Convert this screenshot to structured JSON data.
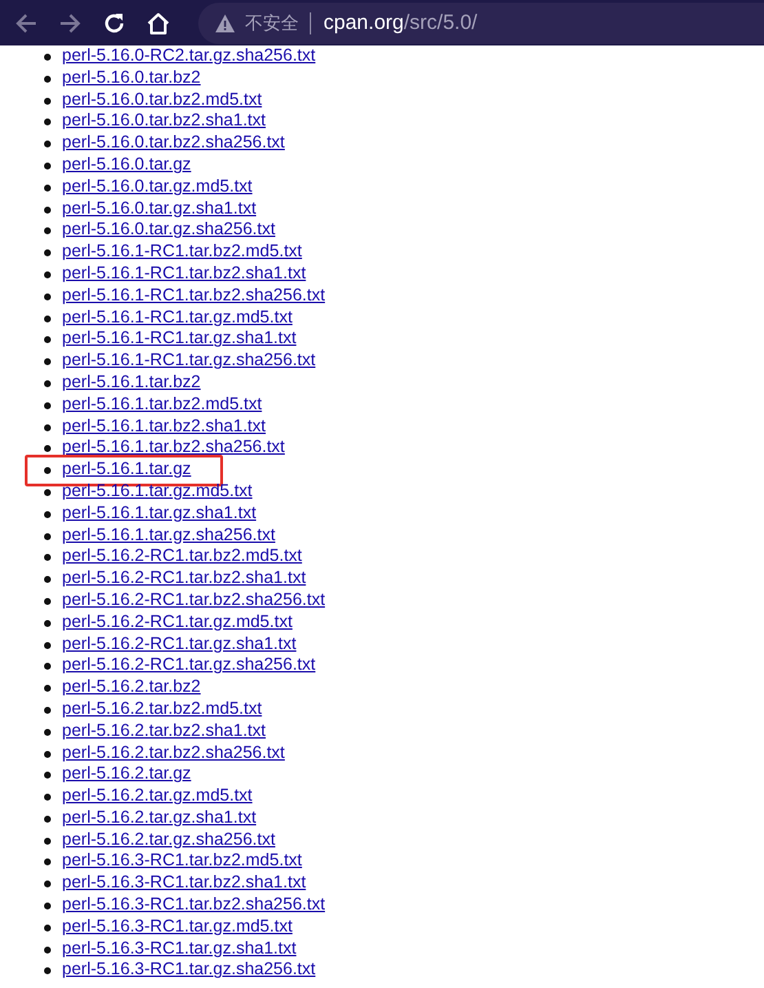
{
  "toolbar": {
    "back_disabled": true,
    "forward_disabled": true,
    "security_label": "不安全",
    "url_host": "cpan.org",
    "url_path": "/src/5.0/"
  },
  "files": [
    {
      "name": "perl-5.16.0-RC2.tar.gz.sha256.txt",
      "highlighted": false
    },
    {
      "name": "perl-5.16.0.tar.bz2",
      "highlighted": false
    },
    {
      "name": "perl-5.16.0.tar.bz2.md5.txt",
      "highlighted": false
    },
    {
      "name": "perl-5.16.0.tar.bz2.sha1.txt",
      "highlighted": false
    },
    {
      "name": "perl-5.16.0.tar.bz2.sha256.txt",
      "highlighted": false
    },
    {
      "name": "perl-5.16.0.tar.gz",
      "highlighted": false
    },
    {
      "name": "perl-5.16.0.tar.gz.md5.txt",
      "highlighted": false
    },
    {
      "name": "perl-5.16.0.tar.gz.sha1.txt",
      "highlighted": false
    },
    {
      "name": "perl-5.16.0.tar.gz.sha256.txt",
      "highlighted": false
    },
    {
      "name": "perl-5.16.1-RC1.tar.bz2.md5.txt",
      "highlighted": false
    },
    {
      "name": "perl-5.16.1-RC1.tar.bz2.sha1.txt",
      "highlighted": false
    },
    {
      "name": "perl-5.16.1-RC1.tar.bz2.sha256.txt",
      "highlighted": false
    },
    {
      "name": "perl-5.16.1-RC1.tar.gz.md5.txt",
      "highlighted": false
    },
    {
      "name": "perl-5.16.1-RC1.tar.gz.sha1.txt",
      "highlighted": false
    },
    {
      "name": "perl-5.16.1-RC1.tar.gz.sha256.txt",
      "highlighted": false
    },
    {
      "name": "perl-5.16.1.tar.bz2",
      "highlighted": false
    },
    {
      "name": "perl-5.16.1.tar.bz2.md5.txt",
      "highlighted": false
    },
    {
      "name": "perl-5.16.1.tar.bz2.sha1.txt",
      "highlighted": false
    },
    {
      "name": "perl-5.16.1.tar.bz2.sha256.txt",
      "highlighted": false
    },
    {
      "name": "perl-5.16.1.tar.gz",
      "highlighted": true
    },
    {
      "name": "perl-5.16.1.tar.gz.md5.txt",
      "highlighted": false
    },
    {
      "name": "perl-5.16.1.tar.gz.sha1.txt",
      "highlighted": false
    },
    {
      "name": "perl-5.16.1.tar.gz.sha256.txt",
      "highlighted": false
    },
    {
      "name": "perl-5.16.2-RC1.tar.bz2.md5.txt",
      "highlighted": false
    },
    {
      "name": "perl-5.16.2-RC1.tar.bz2.sha1.txt",
      "highlighted": false
    },
    {
      "name": "perl-5.16.2-RC1.tar.bz2.sha256.txt",
      "highlighted": false
    },
    {
      "name": "perl-5.16.2-RC1.tar.gz.md5.txt",
      "highlighted": false
    },
    {
      "name": "perl-5.16.2-RC1.tar.gz.sha1.txt",
      "highlighted": false
    },
    {
      "name": "perl-5.16.2-RC1.tar.gz.sha256.txt",
      "highlighted": false
    },
    {
      "name": "perl-5.16.2.tar.bz2",
      "highlighted": false
    },
    {
      "name": "perl-5.16.2.tar.bz2.md5.txt",
      "highlighted": false
    },
    {
      "name": "perl-5.16.2.tar.bz2.sha1.txt",
      "highlighted": false
    },
    {
      "name": "perl-5.16.2.tar.bz2.sha256.txt",
      "highlighted": false
    },
    {
      "name": "perl-5.16.2.tar.gz",
      "highlighted": false
    },
    {
      "name": "perl-5.16.2.tar.gz.md5.txt",
      "highlighted": false
    },
    {
      "name": "perl-5.16.2.tar.gz.sha1.txt",
      "highlighted": false
    },
    {
      "name": "perl-5.16.2.tar.gz.sha256.txt",
      "highlighted": false
    },
    {
      "name": "perl-5.16.3-RC1.tar.bz2.md5.txt",
      "highlighted": false
    },
    {
      "name": "perl-5.16.3-RC1.tar.bz2.sha1.txt",
      "highlighted": false
    },
    {
      "name": "perl-5.16.3-RC1.tar.bz2.sha256.txt",
      "highlighted": false
    },
    {
      "name": "perl-5.16.3-RC1.tar.gz.md5.txt",
      "highlighted": false
    },
    {
      "name": "perl-5.16.3-RC1.tar.gz.sha1.txt",
      "highlighted": false
    },
    {
      "name": "perl-5.16.3-RC1.tar.gz.sha256.txt",
      "highlighted": false
    }
  ]
}
